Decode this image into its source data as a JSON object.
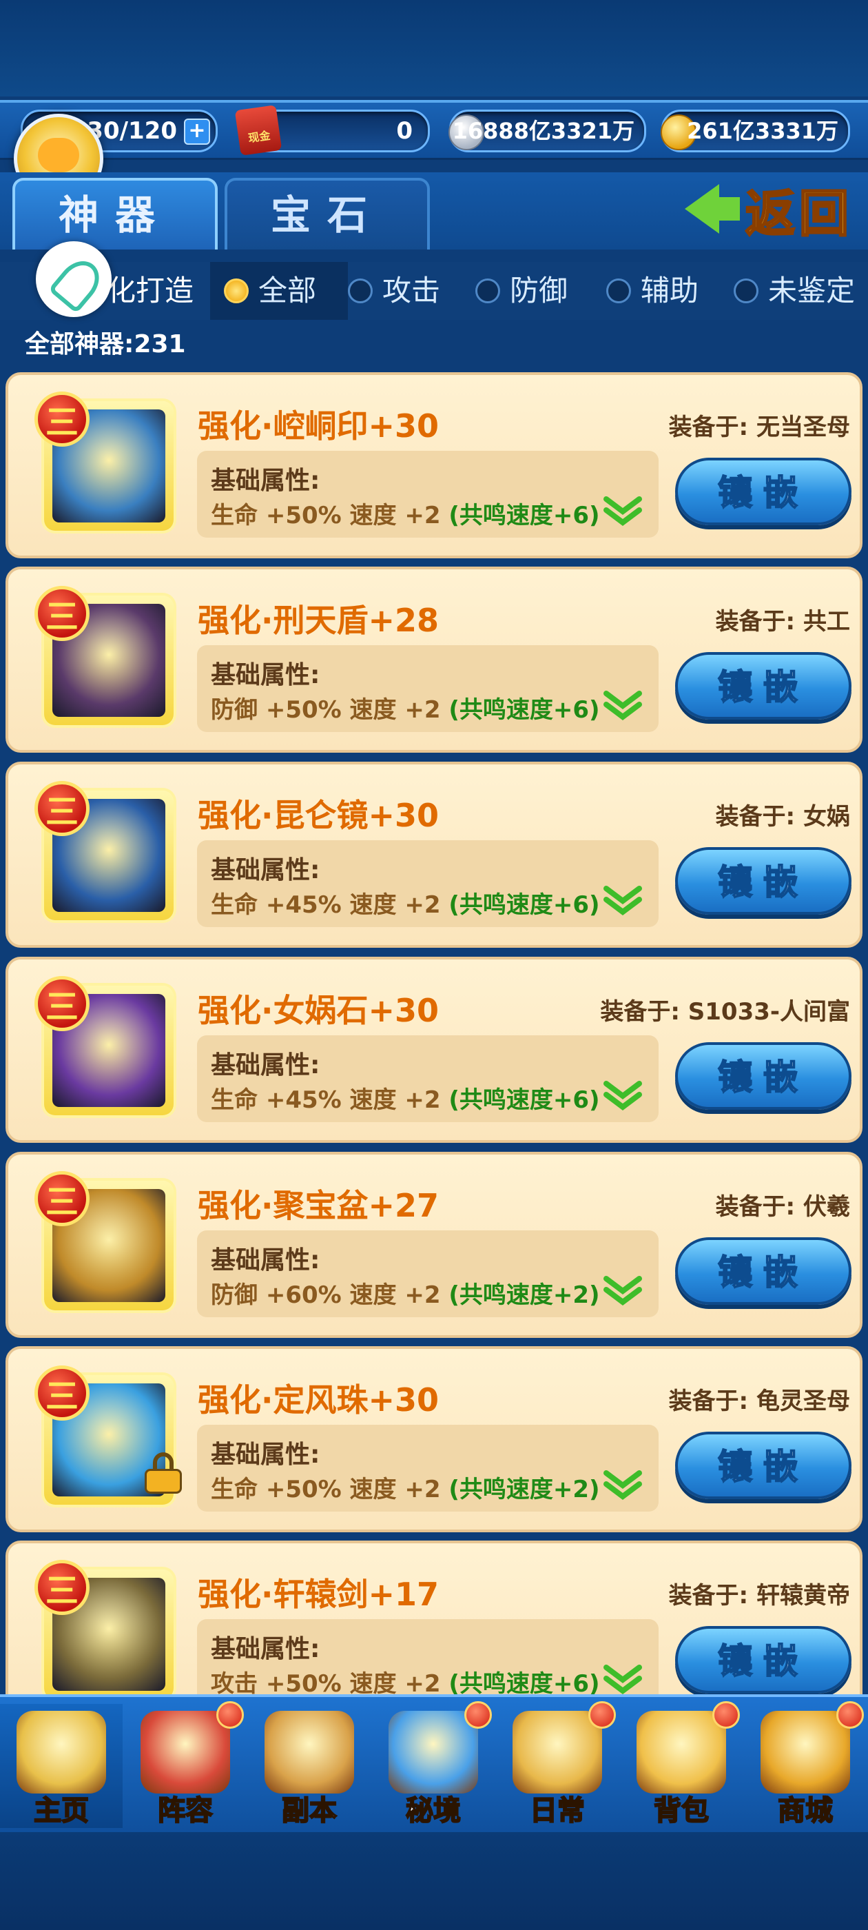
{
  "resources": {
    "stamina": "630/120",
    "cash": "0",
    "silver": "16888亿3321万",
    "gold": "261亿3331万",
    "cash_icon_label": "现金"
  },
  "tabs": [
    {
      "label": "神器",
      "active": true
    },
    {
      "label": "宝石",
      "active": false
    }
  ],
  "back_label": "返回",
  "filter": {
    "forge_label": "化打造",
    "options": [
      {
        "label": "全部",
        "selected": true
      },
      {
        "label": "攻击",
        "selected": false
      },
      {
        "label": "防御",
        "selected": false
      },
      {
        "label": "辅助",
        "selected": false
      },
      {
        "label": "未鉴定",
        "selected": false
      }
    ]
  },
  "total_label": "全部神器:231",
  "attr_title": "基础属性:",
  "inlay_label": "镶嵌",
  "items": [
    {
      "rank": "三",
      "name": "强化·崆峒印+30",
      "equipped": "装备于: 无当圣母",
      "stats": "生命 +50%  速度 +2",
      "resonance": "(共鸣速度+6)",
      "locked": false,
      "art": "#3a7fc0"
    },
    {
      "rank": "三",
      "name": "强化·刑天盾+28",
      "equipped": "装备于: 共工",
      "stats": "防御 +50%  速度 +2",
      "resonance": "(共鸣速度+6)",
      "locked": false,
      "art": "#5a3a6a"
    },
    {
      "rank": "三",
      "name": "强化·昆仑镜+30",
      "equipped": "装备于: 女娲",
      "stats": "生命 +45%  速度 +2",
      "resonance": "(共鸣速度+6)",
      "locked": false,
      "art": "#2a5fa8"
    },
    {
      "rank": "三",
      "name": "强化·女娲石+30",
      "equipped": "装备于: S1033-人间富",
      "stats": "生命 +45%  速度 +2",
      "resonance": "(共鸣速度+6)",
      "locked": false,
      "art": "#6a3aa0"
    },
    {
      "rank": "三",
      "name": "强化·聚宝盆+27",
      "equipped": "装备于: 伏羲",
      "stats": "防御 +60%  速度 +2",
      "resonance": "(共鸣速度+2)",
      "locked": false,
      "art": "#c08a2a"
    },
    {
      "rank": "三",
      "name": "强化·定风珠+30",
      "equipped": "装备于: 龟灵圣母",
      "stats": "生命 +50%  速度 +2",
      "resonance": "(共鸣速度+2)",
      "locked": true,
      "art": "#3aa0e0"
    },
    {
      "rank": "三",
      "name": "强化·轩辕剑+17",
      "equipped": "装备于: 轩辕黄帝",
      "stats": "攻击 +50%  速度 +2",
      "resonance": "(共鸣速度+6)",
      "locked": false,
      "art": "#7a6a3a"
    }
  ],
  "nav": [
    {
      "label": "主页",
      "selected": true,
      "badge": false,
      "color": "#e8c04a"
    },
    {
      "label": "阵容",
      "selected": false,
      "badge": true,
      "color": "#d94a3a"
    },
    {
      "label": "副本",
      "selected": false,
      "badge": false,
      "color": "#d9a24a"
    },
    {
      "label": "秘境",
      "selected": false,
      "badge": true,
      "color": "#4aa0e8"
    },
    {
      "label": "日常",
      "selected": false,
      "badge": true,
      "color": "#e8b84a"
    },
    {
      "label": "背包",
      "selected": false,
      "badge": true,
      "color": "#f0c04a"
    },
    {
      "label": "商城",
      "selected": false,
      "badge": true,
      "color": "#e8a82a"
    }
  ]
}
